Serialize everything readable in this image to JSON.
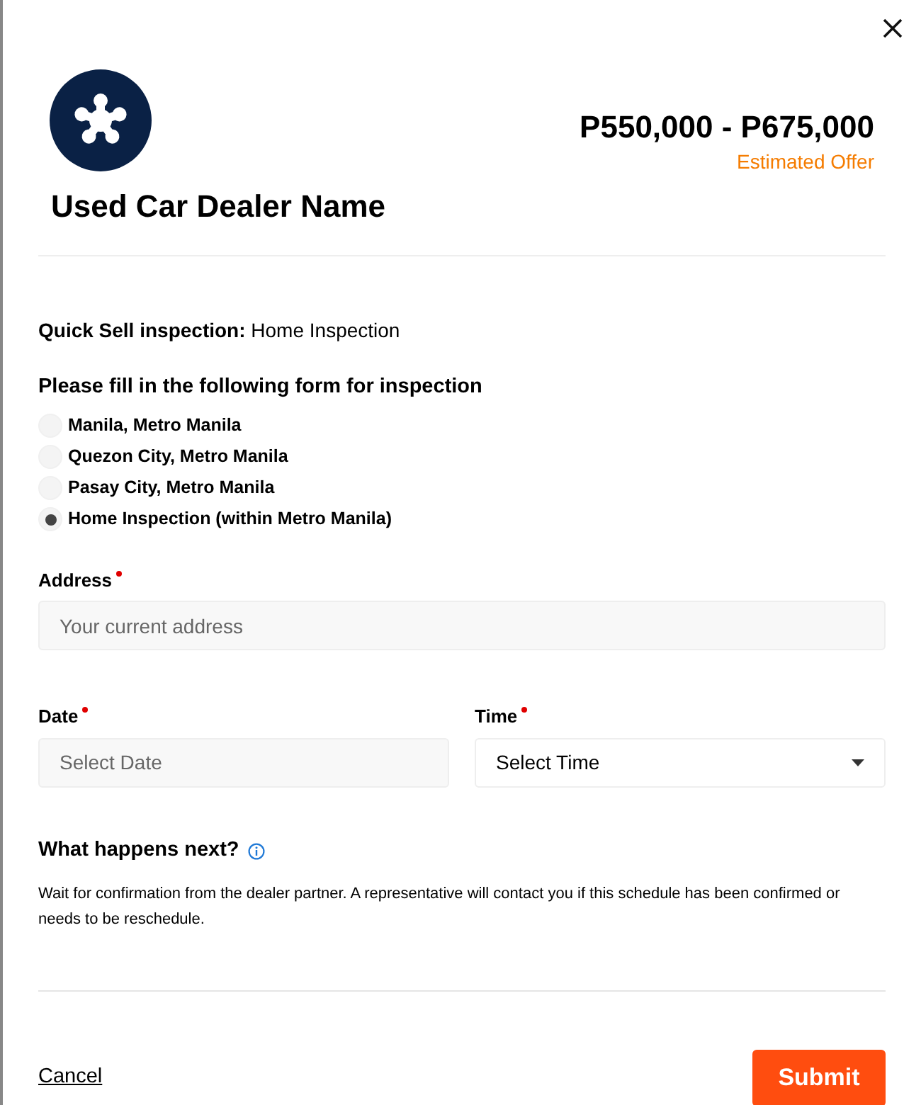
{
  "dealer": {
    "name": "Used Car Dealer Name"
  },
  "offer": {
    "price": "P550,000 - P675,000",
    "label": "Estimated Offer"
  },
  "inspection": {
    "label": "Quick Sell inspection:",
    "value": "Home Inspection"
  },
  "form_title": "Please fill in the following form for inspection",
  "locations": [
    {
      "label": "Manila, Metro Manila",
      "selected": false
    },
    {
      "label": "Quezon City, Metro Manila",
      "selected": false
    },
    {
      "label": "Pasay City, Metro Manila",
      "selected": false
    },
    {
      "label": "Home Inspection (within Metro Manila)",
      "selected": true
    }
  ],
  "address": {
    "label": "Address",
    "required": true,
    "placeholder": "Your current address"
  },
  "date": {
    "label": "Date",
    "required": true,
    "placeholder": "Select Date"
  },
  "time": {
    "label": "Time",
    "required": true,
    "value": "Select Time"
  },
  "next": {
    "title": "What happens next?",
    "text": "Wait for confirmation from the dealer partner. A representative will contact you if this schedule has been confirmed or needs to be reschedule."
  },
  "buttons": {
    "cancel": "Cancel",
    "submit": "Submit"
  }
}
